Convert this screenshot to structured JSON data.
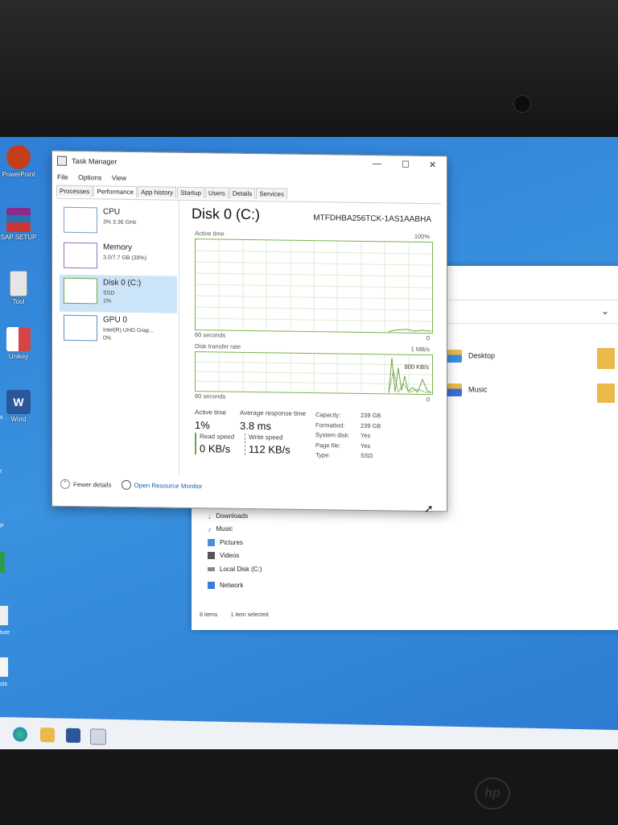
{
  "desktop": {
    "icons": [
      {
        "label": "PowerPoint",
        "icon": "powerpoint-icon",
        "color": "#c43e1c"
      },
      {
        "label": "SAP SETUP",
        "icon": "winrar-icon",
        "color": "#8b2b8f"
      },
      {
        "label": "Tool",
        "icon": "tool-icon",
        "color": "#d9d9d9"
      },
      {
        "label": "Unikey",
        "icon": "unikey-icon",
        "color": "#d64545"
      },
      {
        "label": "Word",
        "icon": "word-icon",
        "color": "#2b579a"
      }
    ],
    "edge_labels": [
      "s",
      "r",
      "P",
      "ture",
      "sts"
    ]
  },
  "explorer": {
    "folders": [
      {
        "label": "Desktop",
        "icon": "desktop-folder-icon"
      },
      {
        "label": "Music",
        "icon": "music-folder-icon"
      }
    ],
    "nav": [
      {
        "label": "Downloads",
        "icon": "download-icon"
      },
      {
        "label": "Music",
        "icon": "music-icon"
      },
      {
        "label": "Pictures",
        "icon": "pictures-icon"
      },
      {
        "label": "Videos",
        "icon": "videos-icon"
      },
      {
        "label": "Local Disk (C:)",
        "icon": "drive-icon"
      },
      {
        "label": "Network",
        "icon": "network-icon"
      }
    ],
    "status": {
      "items": "8 items",
      "selected": "1 item selected"
    }
  },
  "task_manager": {
    "title": "Task Manager",
    "menu": [
      "File",
      "Options",
      "View"
    ],
    "tabs": [
      "Processes",
      "Performance",
      "App history",
      "Startup",
      "Users",
      "Details",
      "Services"
    ],
    "active_tab": "Performance",
    "resources": [
      {
        "name": "CPU",
        "line1": "3% 3.36 GHz",
        "line2": "",
        "line3": ""
      },
      {
        "name": "Memory",
        "line1": "3.0/7.7 GB (39%)",
        "line2": "",
        "line3": ""
      },
      {
        "name": "Disk 0 (C:)",
        "line1": "SSD",
        "line2": "1%",
        "line3": ""
      },
      {
        "name": "GPU 0",
        "line1": "Intel(R) UHD Grap...",
        "line2": "0%",
        "line3": ""
      }
    ],
    "disk": {
      "title": "Disk 0 (C:)",
      "model": "MTFDHBA256TCK-1AS1AABHA",
      "active_time_label": "Active time",
      "active_time_max": "100%",
      "graph1_left": "60 seconds",
      "graph1_right": "0",
      "transfer_label": "Disk transfer rate",
      "transfer_max": "1 MB/s",
      "transfer_mid": "800 KB/s",
      "graph2_left": "60 seconds",
      "graph2_right": "0",
      "stats": {
        "active_time_label": "Active time",
        "active_time": "1%",
        "avg_resp_label": "Average response time",
        "avg_resp": "3.8 ms",
        "read_label": "Read speed",
        "read": "0 KB/s",
        "write_label": "Write speed",
        "write": "112 KB/s"
      },
      "props": [
        {
          "k": "Capacity:",
          "v": "239 GB"
        },
        {
          "k": "Formatted:",
          "v": "239 GB"
        },
        {
          "k": "System disk:",
          "v": "Yes"
        },
        {
          "k": "Page file:",
          "v": "Yes"
        },
        {
          "k": "Type:",
          "v": "SSD"
        }
      ]
    },
    "footer": {
      "fewer": "Fewer details",
      "monitor": "Open Resource Monitor"
    }
  },
  "taskbar": {
    "icons": [
      "edge-icon",
      "explorer-icon",
      "word-icon",
      "task-manager-icon"
    ]
  }
}
